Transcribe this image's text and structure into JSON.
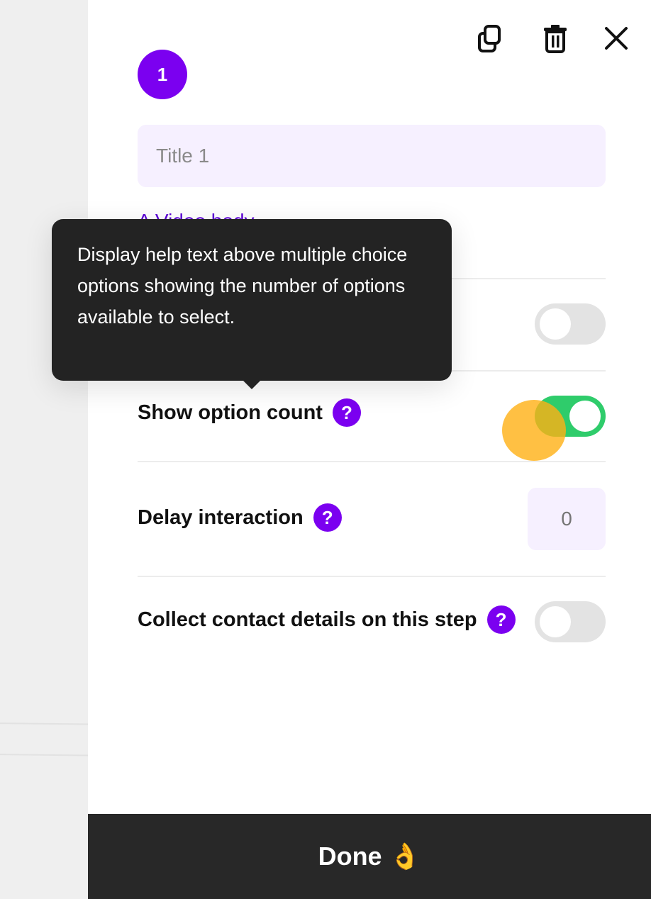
{
  "step": {
    "number": "1"
  },
  "title_field": {
    "placeholder": "Title 1",
    "value": ""
  },
  "partial_row_text": "A     Video  body",
  "rows": {
    "hidden_row": {
      "toggle_on": false
    },
    "show_option_count": {
      "label": "Show option count",
      "help": "?",
      "toggle_on": true
    },
    "delay_interaction": {
      "label": "Delay interaction",
      "help": "?",
      "value": "0"
    },
    "collect_contact": {
      "label": "Collect contact details on this step",
      "help": "?",
      "toggle_on": false
    }
  },
  "tooltip": {
    "text": "Display help text above multiple choice options showing the number of options available to select."
  },
  "footer": {
    "done_label": "Done",
    "done_emoji": "👌"
  },
  "icons": {
    "duplicate": "copy-icon",
    "delete": "trash-icon",
    "close": "close-icon"
  },
  "colors": {
    "accent": "#7b00f0",
    "toggle_on": "#2fcc6b",
    "toggle_off": "#e3e3e3",
    "input_bg": "#f6f0ff",
    "footer_bg": "#282828"
  }
}
